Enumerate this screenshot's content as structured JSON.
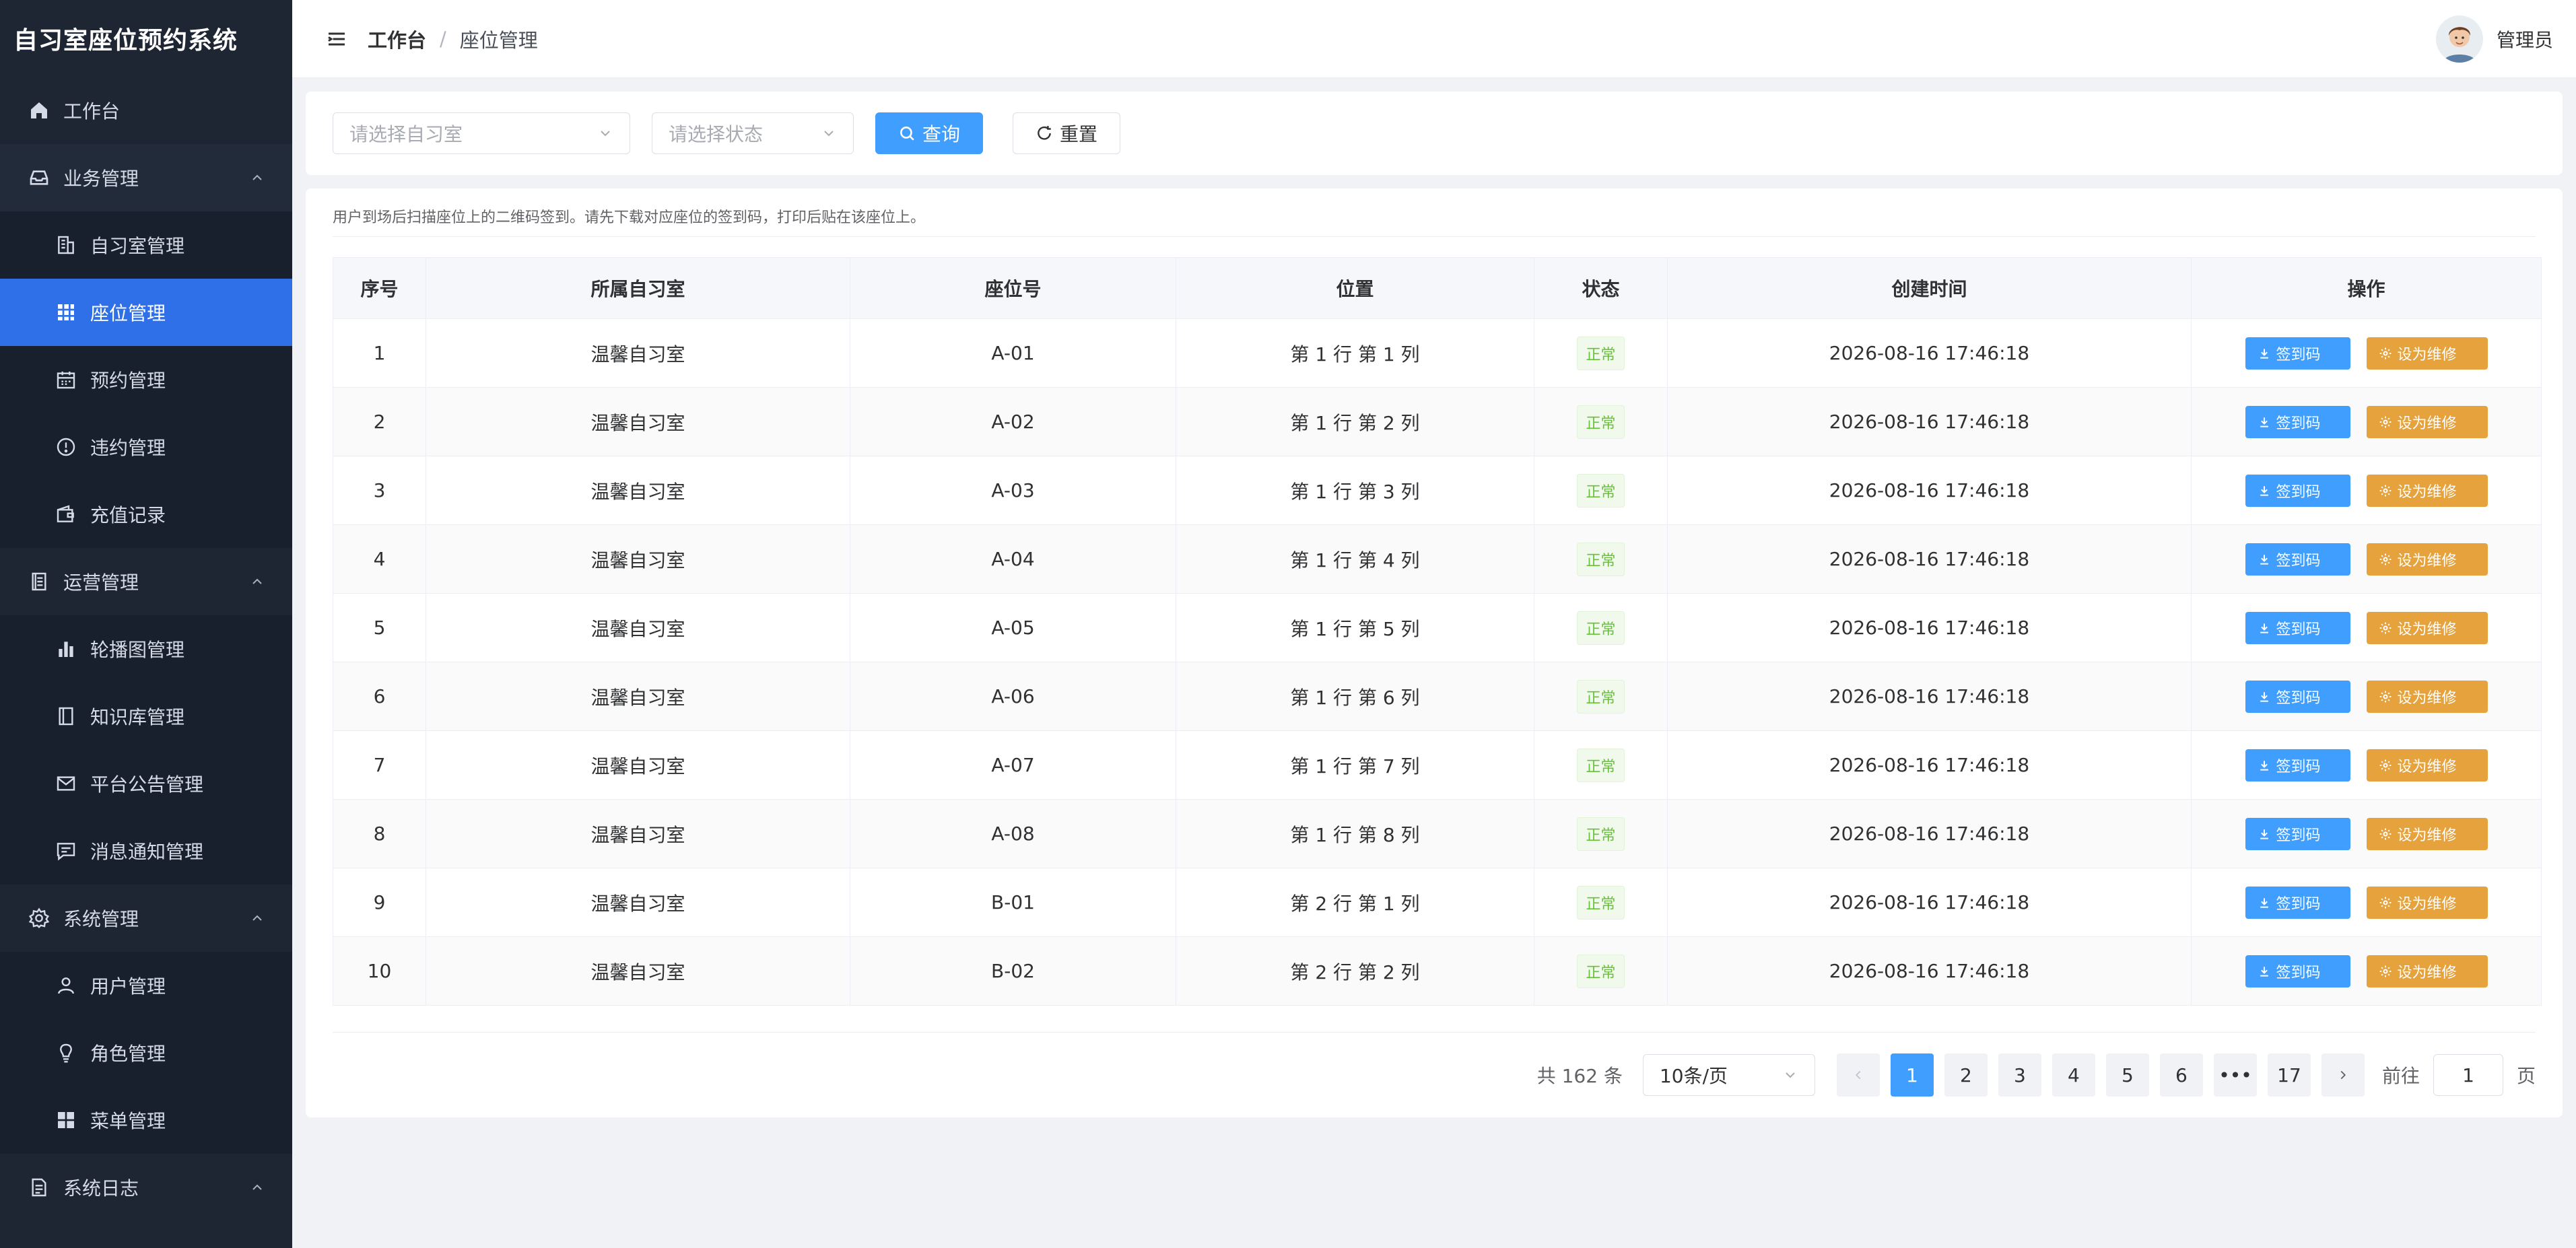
{
  "app": {
    "title": "自习室座位预约系统"
  },
  "sidebar": {
    "workbench": "工作台",
    "groups": [
      {
        "label": "业务管理",
        "items": [
          "自习室管理",
          "座位管理",
          "预约管理",
          "违约管理",
          "充值记录"
        ]
      },
      {
        "label": "运营管理",
        "items": [
          "轮播图管理",
          "知识库管理",
          "平台公告管理",
          "消息通知管理"
        ]
      },
      {
        "label": "系统管理",
        "items": [
          "用户管理",
          "角色管理",
          "菜单管理"
        ]
      },
      {
        "label": "系统日志",
        "items": []
      }
    ],
    "active_item": "座位管理"
  },
  "header": {
    "breadcrumb_home": "工作台",
    "breadcrumb_sep": "/",
    "breadcrumb_current": "座位管理",
    "user_name": "管理员"
  },
  "filters": {
    "room_placeholder": "请选择自习室",
    "status_placeholder": "请选择状态",
    "query_label": "查询",
    "reset_label": "重置"
  },
  "hint": "用户到场后扫描座位上的二维码签到。请先下载对应座位的签到码，打印后贴在该座位上。",
  "table": {
    "columns": [
      "序号",
      "所属自习室",
      "座位号",
      "位置",
      "状态",
      "创建时间",
      "操作"
    ],
    "rows": [
      {
        "index": "1",
        "room": "温馨自习室",
        "seat": "A-01",
        "position": "第 1 行 第 1 列",
        "status": "正常",
        "created": "2026-08-16 17:46:18"
      },
      {
        "index": "2",
        "room": "温馨自习室",
        "seat": "A-02",
        "position": "第 1 行 第 2 列",
        "status": "正常",
        "created": "2026-08-16 17:46:18"
      },
      {
        "index": "3",
        "room": "温馨自习室",
        "seat": "A-03",
        "position": "第 1 行 第 3 列",
        "status": "正常",
        "created": "2026-08-16 17:46:18"
      },
      {
        "index": "4",
        "room": "温馨自习室",
        "seat": "A-04",
        "position": "第 1 行 第 4 列",
        "status": "正常",
        "created": "2026-08-16 17:46:18"
      },
      {
        "index": "5",
        "room": "温馨自习室",
        "seat": "A-05",
        "position": "第 1 行 第 5 列",
        "status": "正常",
        "created": "2026-08-16 17:46:18"
      },
      {
        "index": "6",
        "room": "温馨自习室",
        "seat": "A-06",
        "position": "第 1 行 第 6 列",
        "status": "正常",
        "created": "2026-08-16 17:46:18"
      },
      {
        "index": "7",
        "room": "温馨自习室",
        "seat": "A-07",
        "position": "第 1 行 第 7 列",
        "status": "正常",
        "created": "2026-08-16 17:46:18"
      },
      {
        "index": "8",
        "room": "温馨自习室",
        "seat": "A-08",
        "position": "第 1 行 第 8 列",
        "status": "正常",
        "created": "2026-08-16 17:46:18"
      },
      {
        "index": "9",
        "room": "温馨自习室",
        "seat": "B-01",
        "position": "第 2 行 第 1 列",
        "status": "正常",
        "created": "2026-08-16 17:46:18"
      },
      {
        "index": "10",
        "room": "温馨自习室",
        "seat": "B-02",
        "position": "第 2 行 第 2 列",
        "status": "正常",
        "created": "2026-08-16 17:46:18"
      }
    ],
    "action_checkin": "签到码",
    "action_repair": "设为维修"
  },
  "pagination": {
    "total_text": "共 162 条",
    "page_size": "10条/页",
    "pages": [
      "1",
      "2",
      "3",
      "4",
      "5",
      "6",
      "•••",
      "17"
    ],
    "current_page": "1",
    "jump_prefix": "前往",
    "jump_value": "1",
    "jump_suffix": "页"
  },
  "colors": {
    "primary": "#409eff",
    "warning": "#e6a23c",
    "success": "#67c23a",
    "sidebar_bg": "#1f2633",
    "sidebar_active": "#2f6fe8"
  },
  "icons": {
    "home": "home-icon",
    "business": "inbox-icon",
    "room": "building-icon",
    "seat": "grid-icon",
    "reservation": "calendar-icon",
    "violation": "warning-icon",
    "recharge": "wallet-icon",
    "operation": "document-icon",
    "carousel": "bar-chart-icon",
    "knowledge": "book-icon",
    "notice": "mail-icon",
    "message": "chat-icon",
    "system": "gear-icon",
    "user": "user-icon",
    "role": "bulb-icon",
    "menu": "apps-icon",
    "log": "log-icon"
  }
}
